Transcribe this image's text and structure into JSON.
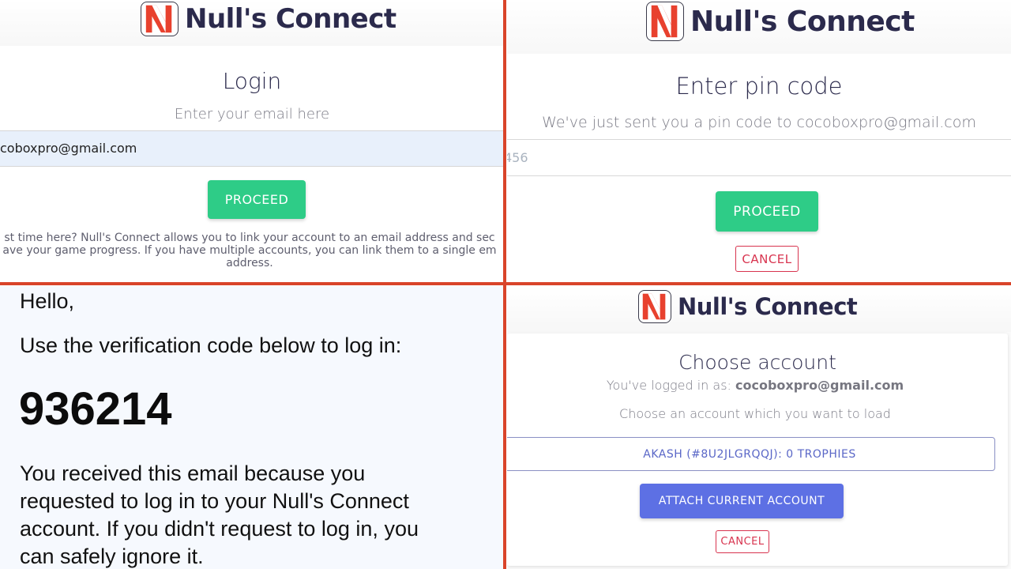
{
  "brand": {
    "name": "Null's Connect",
    "logo_icon": "n-logo-icon",
    "logo_colors": {
      "red": "#e8412e",
      "white": "#ffffff"
    }
  },
  "login_panel": {
    "title": "Login",
    "subtitle": "Enter your email here",
    "email_value": "coboxpro@gmail.com",
    "proceed_label": "PROCEED",
    "info_line1": "st time here? Null's Connect allows you to link your account to an email address and sec",
    "info_line2": "ave your game progress. If you have multiple accounts, you can link them to a single em",
    "info_line3": "address."
  },
  "pin_panel": {
    "title": "Enter pin code",
    "subtitle": "We've just sent you a pin code to cocoboxpro@gmail.com",
    "pin_placeholder": "456",
    "proceed_label": "PROCEED",
    "cancel_label": "CANCEL"
  },
  "email_panel": {
    "greeting": "Hello,",
    "instruction": "Use the verification code below to log in:",
    "code": "936214",
    "footer_line1": "You received this email because you",
    "footer_line2": "requested to log in to your Null's Connect",
    "footer_line3": "account. If you didn't request to log in, you",
    "footer_line4": "can safely ignore it."
  },
  "choose_panel": {
    "title": "Choose account",
    "logged_in_prefix": "You've logged in as: ",
    "logged_in_email": "cocoboxpro@gmail.com",
    "instruction": "Choose an account which you want to load",
    "accounts": [
      {
        "label": "AKASH (#8U2JLGRQQJ): 0 TROPHIES"
      }
    ],
    "attach_label": "ATTACH CURRENT ACCOUNT",
    "cancel_label": "CANCEL"
  },
  "colors": {
    "divider": "#d9442a",
    "proceed": "#2ecc87",
    "attach": "#5d70e4",
    "cancel": "#d8344f",
    "title": "#2b2a4c"
  }
}
